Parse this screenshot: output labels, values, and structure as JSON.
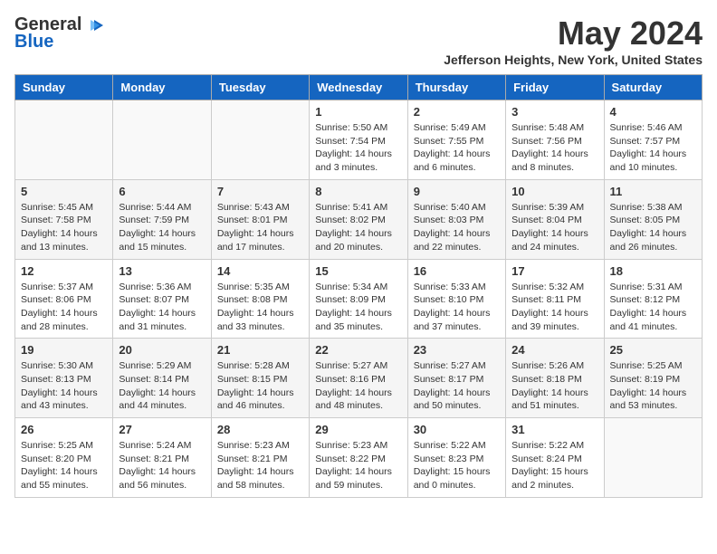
{
  "logo": {
    "general": "General",
    "blue": "Blue"
  },
  "title": "May 2024",
  "location": "Jefferson Heights, New York, United States",
  "days_of_week": [
    "Sunday",
    "Monday",
    "Tuesday",
    "Wednesday",
    "Thursday",
    "Friday",
    "Saturday"
  ],
  "weeks": [
    [
      {
        "day": "",
        "info": ""
      },
      {
        "day": "",
        "info": ""
      },
      {
        "day": "",
        "info": ""
      },
      {
        "day": "1",
        "info": "Sunrise: 5:50 AM\nSunset: 7:54 PM\nDaylight: 14 hours\nand 3 minutes."
      },
      {
        "day": "2",
        "info": "Sunrise: 5:49 AM\nSunset: 7:55 PM\nDaylight: 14 hours\nand 6 minutes."
      },
      {
        "day": "3",
        "info": "Sunrise: 5:48 AM\nSunset: 7:56 PM\nDaylight: 14 hours\nand 8 minutes."
      },
      {
        "day": "4",
        "info": "Sunrise: 5:46 AM\nSunset: 7:57 PM\nDaylight: 14 hours\nand 10 minutes."
      }
    ],
    [
      {
        "day": "5",
        "info": "Sunrise: 5:45 AM\nSunset: 7:58 PM\nDaylight: 14 hours\nand 13 minutes."
      },
      {
        "day": "6",
        "info": "Sunrise: 5:44 AM\nSunset: 7:59 PM\nDaylight: 14 hours\nand 15 minutes."
      },
      {
        "day": "7",
        "info": "Sunrise: 5:43 AM\nSunset: 8:01 PM\nDaylight: 14 hours\nand 17 minutes."
      },
      {
        "day": "8",
        "info": "Sunrise: 5:41 AM\nSunset: 8:02 PM\nDaylight: 14 hours\nand 20 minutes."
      },
      {
        "day": "9",
        "info": "Sunrise: 5:40 AM\nSunset: 8:03 PM\nDaylight: 14 hours\nand 22 minutes."
      },
      {
        "day": "10",
        "info": "Sunrise: 5:39 AM\nSunset: 8:04 PM\nDaylight: 14 hours\nand 24 minutes."
      },
      {
        "day": "11",
        "info": "Sunrise: 5:38 AM\nSunset: 8:05 PM\nDaylight: 14 hours\nand 26 minutes."
      }
    ],
    [
      {
        "day": "12",
        "info": "Sunrise: 5:37 AM\nSunset: 8:06 PM\nDaylight: 14 hours\nand 28 minutes."
      },
      {
        "day": "13",
        "info": "Sunrise: 5:36 AM\nSunset: 8:07 PM\nDaylight: 14 hours\nand 31 minutes."
      },
      {
        "day": "14",
        "info": "Sunrise: 5:35 AM\nSunset: 8:08 PM\nDaylight: 14 hours\nand 33 minutes."
      },
      {
        "day": "15",
        "info": "Sunrise: 5:34 AM\nSunset: 8:09 PM\nDaylight: 14 hours\nand 35 minutes."
      },
      {
        "day": "16",
        "info": "Sunrise: 5:33 AM\nSunset: 8:10 PM\nDaylight: 14 hours\nand 37 minutes."
      },
      {
        "day": "17",
        "info": "Sunrise: 5:32 AM\nSunset: 8:11 PM\nDaylight: 14 hours\nand 39 minutes."
      },
      {
        "day": "18",
        "info": "Sunrise: 5:31 AM\nSunset: 8:12 PM\nDaylight: 14 hours\nand 41 minutes."
      }
    ],
    [
      {
        "day": "19",
        "info": "Sunrise: 5:30 AM\nSunset: 8:13 PM\nDaylight: 14 hours\nand 43 minutes."
      },
      {
        "day": "20",
        "info": "Sunrise: 5:29 AM\nSunset: 8:14 PM\nDaylight: 14 hours\nand 44 minutes."
      },
      {
        "day": "21",
        "info": "Sunrise: 5:28 AM\nSunset: 8:15 PM\nDaylight: 14 hours\nand 46 minutes."
      },
      {
        "day": "22",
        "info": "Sunrise: 5:27 AM\nSunset: 8:16 PM\nDaylight: 14 hours\nand 48 minutes."
      },
      {
        "day": "23",
        "info": "Sunrise: 5:27 AM\nSunset: 8:17 PM\nDaylight: 14 hours\nand 50 minutes."
      },
      {
        "day": "24",
        "info": "Sunrise: 5:26 AM\nSunset: 8:18 PM\nDaylight: 14 hours\nand 51 minutes."
      },
      {
        "day": "25",
        "info": "Sunrise: 5:25 AM\nSunset: 8:19 PM\nDaylight: 14 hours\nand 53 minutes."
      }
    ],
    [
      {
        "day": "26",
        "info": "Sunrise: 5:25 AM\nSunset: 8:20 PM\nDaylight: 14 hours\nand 55 minutes."
      },
      {
        "day": "27",
        "info": "Sunrise: 5:24 AM\nSunset: 8:21 PM\nDaylight: 14 hours\nand 56 minutes."
      },
      {
        "day": "28",
        "info": "Sunrise: 5:23 AM\nSunset: 8:21 PM\nDaylight: 14 hours\nand 58 minutes."
      },
      {
        "day": "29",
        "info": "Sunrise: 5:23 AM\nSunset: 8:22 PM\nDaylight: 14 hours\nand 59 minutes."
      },
      {
        "day": "30",
        "info": "Sunrise: 5:22 AM\nSunset: 8:23 PM\nDaylight: 15 hours\nand 0 minutes."
      },
      {
        "day": "31",
        "info": "Sunrise: 5:22 AM\nSunset: 8:24 PM\nDaylight: 15 hours\nand 2 minutes."
      },
      {
        "day": "",
        "info": ""
      }
    ]
  ]
}
